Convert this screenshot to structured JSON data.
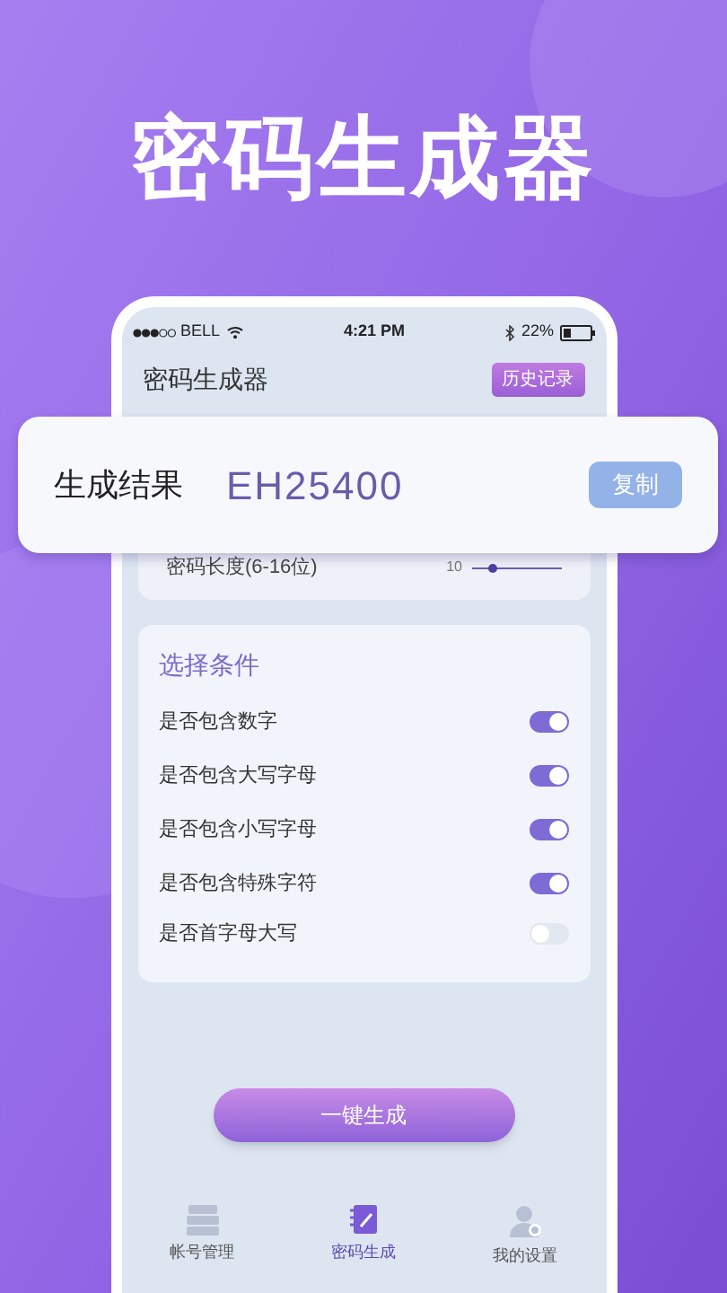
{
  "headline": "密码生成器",
  "status_bar": {
    "carrier": "BELL",
    "time": "4:21 PM",
    "battery": "22%"
  },
  "header": {
    "title": "密码生成器",
    "history_button": "历史记录"
  },
  "result": {
    "label": "生成结果",
    "value": "EH25400",
    "copy_button": "复制"
  },
  "length": {
    "label": "密码长度(6-16位)",
    "reading": "10",
    "level": 0.24
  },
  "conditions": {
    "title": "选择条件",
    "items": [
      {
        "label": "是否包含数字",
        "on": true
      },
      {
        "label": "是否包含大写字母",
        "on": true
      },
      {
        "label": "是否包含小写字母",
        "on": true
      },
      {
        "label": "是否包含特殊字符",
        "on": true
      },
      {
        "label": "是否首字母大写",
        "on": false
      }
    ]
  },
  "generate_button": "一键生成",
  "tabs": [
    {
      "label": "帐号管理",
      "selected": false,
      "kind": "accounts"
    },
    {
      "label": "密码生成",
      "selected": true,
      "kind": "generate"
    },
    {
      "label": "我的设置",
      "selected": false,
      "kind": "settings"
    }
  ]
}
